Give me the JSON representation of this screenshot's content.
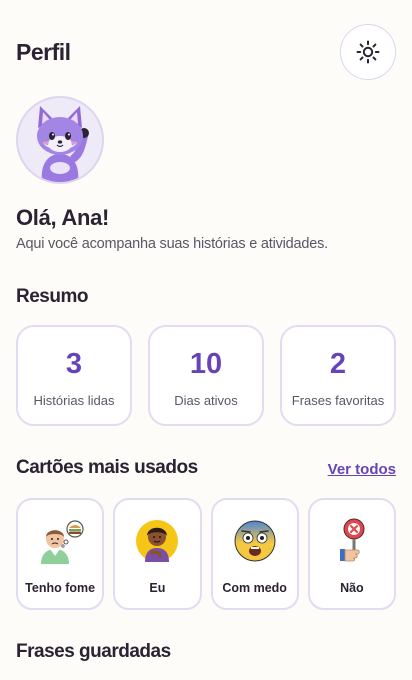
{
  "header": {
    "title": "Perfil"
  },
  "theme_toggle": {
    "icon": "sun-icon"
  },
  "profile": {
    "avatar_icon": "fox-avatar-icon",
    "greeting": "Olá, Ana!",
    "subtitle": "Aqui você acompanha suas histórias e atividades."
  },
  "summary": {
    "title": "Resumo",
    "stats": [
      {
        "value": "3",
        "label": "Histórias lidas"
      },
      {
        "value": "10",
        "label": "Dias ativos"
      },
      {
        "value": "2",
        "label": "Frases favoritas"
      }
    ]
  },
  "cards_section": {
    "title": "Cartões mais usados",
    "see_all": "Ver todos",
    "cards": [
      {
        "label": "Tenho fome",
        "icon": "hungry-person-icon"
      },
      {
        "label": "Eu",
        "icon": "me-child-icon"
      },
      {
        "label": "Com medo",
        "icon": "scared-face-icon"
      },
      {
        "label": "Não",
        "icon": "no-sign-icon"
      }
    ]
  },
  "saved_phrases": {
    "title": "Frases guardadas"
  },
  "colors": {
    "accent": "#6644b8",
    "background": "#fdfcf8",
    "card_border": "#e2dbf1",
    "text": "#2b2333"
  }
}
